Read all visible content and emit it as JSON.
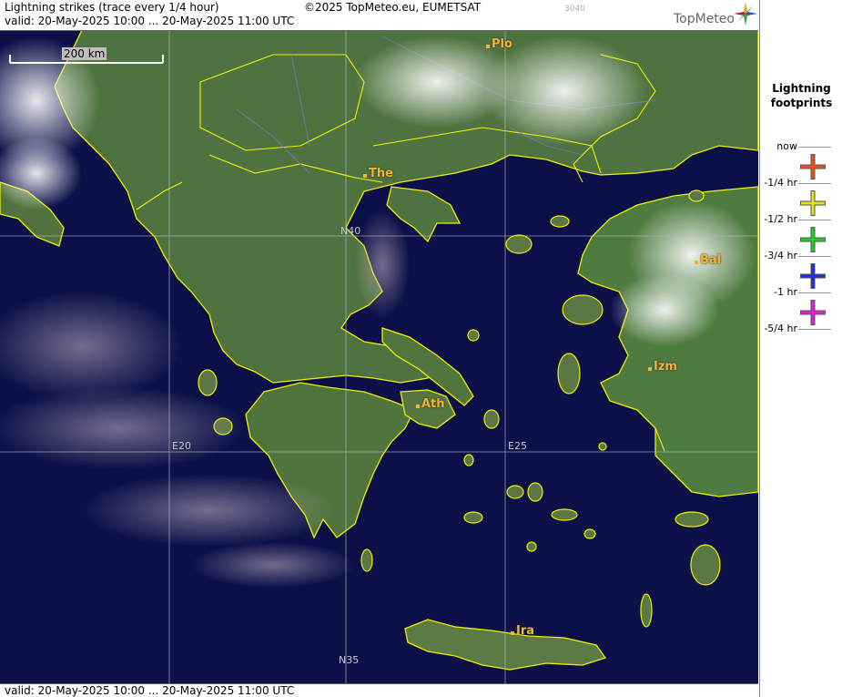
{
  "header": {
    "title": "Lightning strikes (trace every 1/4 hour)",
    "copyright": "©2025 TopMeteo.eu, EUMETSAT",
    "code": "3040",
    "valid": "valid:  20-May-2025 10:00 ... 20-May-2025 11:00 UTC",
    "logo": "TopMeteo"
  },
  "footer": {
    "valid": "valid:  20-May-2025 10:00 ... 20-May-2025 11:00 UTC"
  },
  "scale": {
    "label": "200 km"
  },
  "cities": [
    {
      "id": "plo",
      "label": "Plo"
    },
    {
      "id": "the",
      "label": "The"
    },
    {
      "id": "bal",
      "label": "Bal"
    },
    {
      "id": "izm",
      "label": "Izm"
    },
    {
      "id": "ath",
      "label": "Ath"
    },
    {
      "id": "ira",
      "label": "Ira"
    }
  ],
  "grid_labels": {
    "n40": "N40",
    "e20": "E20",
    "e25": "E25",
    "n35": "N35"
  },
  "legend": {
    "title_line1": "Lightning",
    "title_line2": "footprints",
    "items": [
      {
        "label": "now",
        "color": ""
      },
      {
        "label": "-1/4 hr",
        "color": "#e8501a"
      },
      {
        "label": "-1/2 hr",
        "color": "#e8e020"
      },
      {
        "label": "-3/4 hr",
        "color": "#20d020"
      },
      {
        "label": "-1 hr",
        "color": "#1a30d8"
      },
      {
        "label": "-5/4 hr",
        "color": "#e020d0"
      }
    ]
  },
  "colors": {
    "coast": "#f0f000",
    "sea": "#0b1148",
    "land": "#4a6e3a",
    "city": "#f0b43a"
  }
}
